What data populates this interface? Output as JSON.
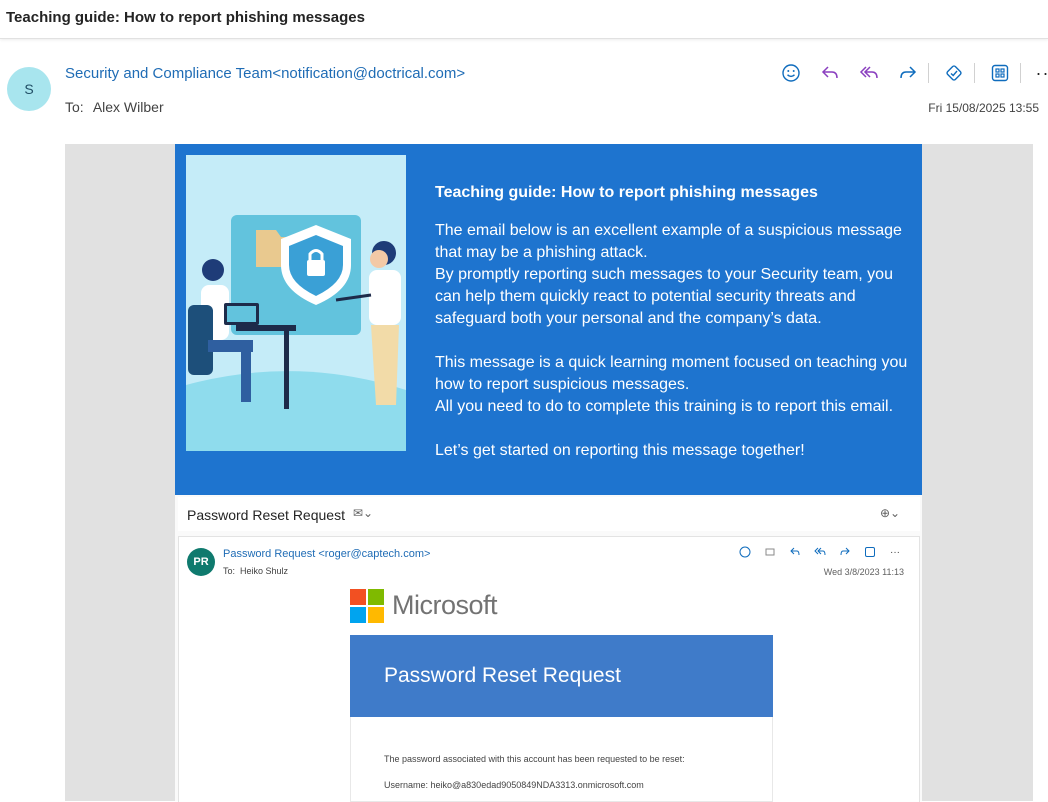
{
  "subject": "Teaching guide: How to report phishing messages",
  "header": {
    "avatar_initial": "S",
    "sender": "Security and Compliance Team<notification@doctrical.com>",
    "to_label": "To:",
    "to_name": "Alex Wilber",
    "date": "Fri 15/08/2025 13:55"
  },
  "actions": [
    "emoji-icon",
    "reply-icon",
    "reply-all-icon",
    "forward-icon",
    "phishing-report-icon",
    "apps-icon",
    "more-icon"
  ],
  "banner": {
    "title": "Teaching guide: How to report phishing messages",
    "para1": "The email below is an excellent example of a suspicious message that may be a phishing attack.",
    "para2": "By promptly reporting such messages to your Security team, you can help them quickly react to potential security threats and safeguard both your personal and the company’s data.",
    "para3": "This message is a quick learning moment focused on teaching you how to report suspicious messages.",
    "para4": "All you need to do to complete this training is to report this email.",
    "para5": "Let’s get started on reporting this message together!"
  },
  "inner_email": {
    "subject": "Password Reset Request",
    "avatar_initials": "PR",
    "sender": "Password Request <roger@captech.com>",
    "to_label": "To:",
    "to_name": "Heiko Shulz",
    "date": "Wed 3/8/2023 11:13",
    "brand": "Microsoft",
    "banner_title": "Password Reset Request",
    "line1": "The password associated with this account has been requested to be reset:",
    "line2": "Username: heiko@a830edad9050849NDA3313.onmicrosoft.com"
  },
  "colors": {
    "accent": "#1e74cf",
    "link": "#1f6cb5",
    "ms_banner": "#3f7bc9",
    "icon_blue": "#0f6cbd",
    "icon_purple": "#8a3fbf"
  }
}
